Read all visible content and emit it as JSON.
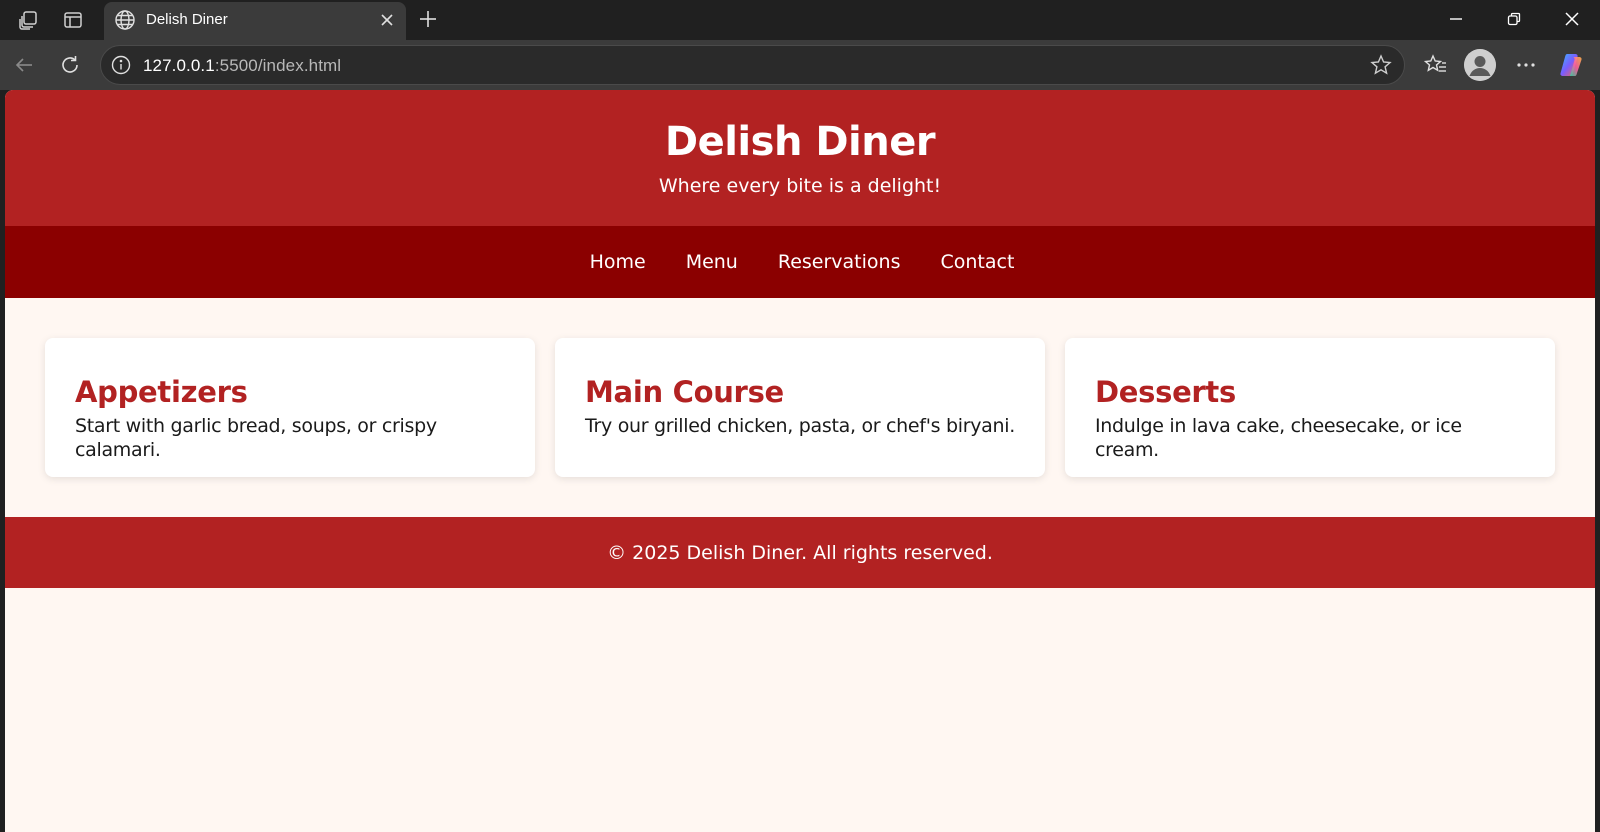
{
  "browser": {
    "tab_title": "Delish Diner",
    "url_host": "127.0.0.1",
    "url_rest": ":5500/index.html",
    "icons": [
      "workspaces-icon",
      "vertical-tabs-icon",
      "globe-icon",
      "close-icon",
      "plus-icon",
      "minimize-icon",
      "restore-icon",
      "window-close-icon",
      "back-icon",
      "reload-icon",
      "info-icon",
      "star-icon",
      "favorites-icon",
      "avatar-icon",
      "more-icon",
      "copilot-icon"
    ]
  },
  "header": {
    "title": "Delish Diner",
    "tagline": "Where every bite is a delight!"
  },
  "nav": {
    "items": [
      {
        "label": "Home"
      },
      {
        "label": "Menu"
      },
      {
        "label": "Reservations"
      },
      {
        "label": "Contact"
      }
    ]
  },
  "cards": [
    {
      "title": "Appetizers",
      "text": "Start with garlic bread, soups, or crispy calamari."
    },
    {
      "title": "Main Course",
      "text": "Try our grilled chicken, pasta, or chef's biryani."
    },
    {
      "title": "Desserts",
      "text": "Indulge in lava cake, cheesecake, or ice cream."
    }
  ],
  "footer": {
    "text": "© 2025 Delish Diner. All rights reserved."
  },
  "colors": {
    "header_bg": "#b22222",
    "nav_bg": "#8b0000",
    "page_bg": "#fff7f2",
    "card_title": "#b22222"
  }
}
